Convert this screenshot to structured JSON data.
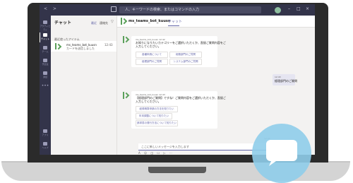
{
  "titlebar": {
    "search_placeholder": "人、キーワードの検索、またはコマンドの入力"
  },
  "rail": {
    "items": [
      {
        "label": "アクティビティ",
        "icon": "bell-icon",
        "active": false
      },
      {
        "label": "チャット",
        "icon": "chat-icon",
        "active": true
      },
      {
        "label": "チーム",
        "icon": "teams-icon",
        "active": false
      },
      {
        "label": "予定表",
        "icon": "calendar-icon",
        "active": false
      },
      {
        "label": "通話",
        "icon": "call-icon",
        "active": false
      },
      {
        "label": "",
        "icon": "more-icon",
        "active": false
      }
    ],
    "bottom": [
      {
        "label": "アプリ",
        "icon": "apps-icon"
      },
      {
        "label": "ヘルプ",
        "icon": "help-icon"
      }
    ]
  },
  "chat_list": {
    "title": "チャット",
    "tabs": [
      "最近",
      "連絡先"
    ],
    "recent_label": "最近使ったアイテム",
    "items": [
      {
        "name": "ms_teams_bot_kuusn",
        "time": "12:43",
        "preview": "カードを送信しました"
      }
    ]
  },
  "chat_header": {
    "name": "ms_teams_bot_kuusn",
    "tab": "チャット"
  },
  "messages": {
    "card1": {
      "sender": "ms_teams_bot_kuusn  12:42",
      "text1": "お知りになりたいカテゴリーをご選択いただくか、直接ご質問内容をご",
      "text2": "入力してください。",
      "buttons": [
        "各種申請について",
        "総務部門のご質問",
        "経理部門のご質問",
        "システム部門のご質問"
      ]
    },
    "user_reply": {
      "sender": "12:43",
      "text": "経理部門のご質問"
    },
    "card2": {
      "sender": "ms_teams_bot_kuusn  12:43",
      "text1": "【経理部門のご質問】ですね！ご質問内容をご選択いただくか、直接ご",
      "text2": "入力してください。",
      "buttons": [
        "経費精算申請の方法を知りたい",
        "年末調整について知りたい",
        "請求書の発行方法について知りたい"
      ]
    },
    "timestamp": "12:43"
  },
  "compose": {
    "placeholder": "ここに新しいメッセージを入力します",
    "tools": "A ☺ ◫ ☐ ▷ ⋯",
    "send_icon": "send-icon"
  },
  "overlay": {
    "icon": "chat-bubble-icon",
    "color": "#8fcdea"
  }
}
